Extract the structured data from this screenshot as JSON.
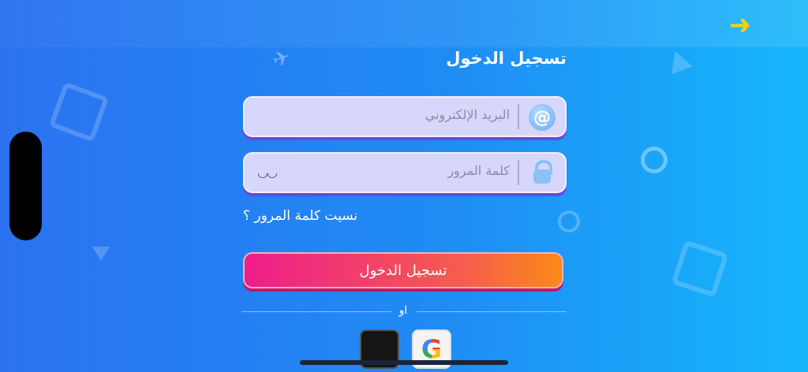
{
  "header": {
    "title": "تسجيل الدخول",
    "back_icon": "arrow-right-icon",
    "back_glyph": "➜"
  },
  "form": {
    "email": {
      "placeholder": "البريد الإلكتروني",
      "icon": "at-sign-icon",
      "icon_glyph": "@"
    },
    "password": {
      "placeholder": "كلمة المرور",
      "icon": "lock-icon",
      "toggle_icon": "eye-closed-icon"
    },
    "forgot_password": "نسيت كلمة المرور ؟",
    "login_button": "تسجيل الدخول",
    "or_text": "او"
  },
  "social": {
    "apple_icon": "apple-icon",
    "google_icon": "google-icon",
    "google_glyph": "G"
  },
  "colors": {
    "accent_arrow": "#f7cf14",
    "field_bg": "#d6d7fb",
    "button_start": "#ee1d8b",
    "button_end": "#fb8a18"
  }
}
